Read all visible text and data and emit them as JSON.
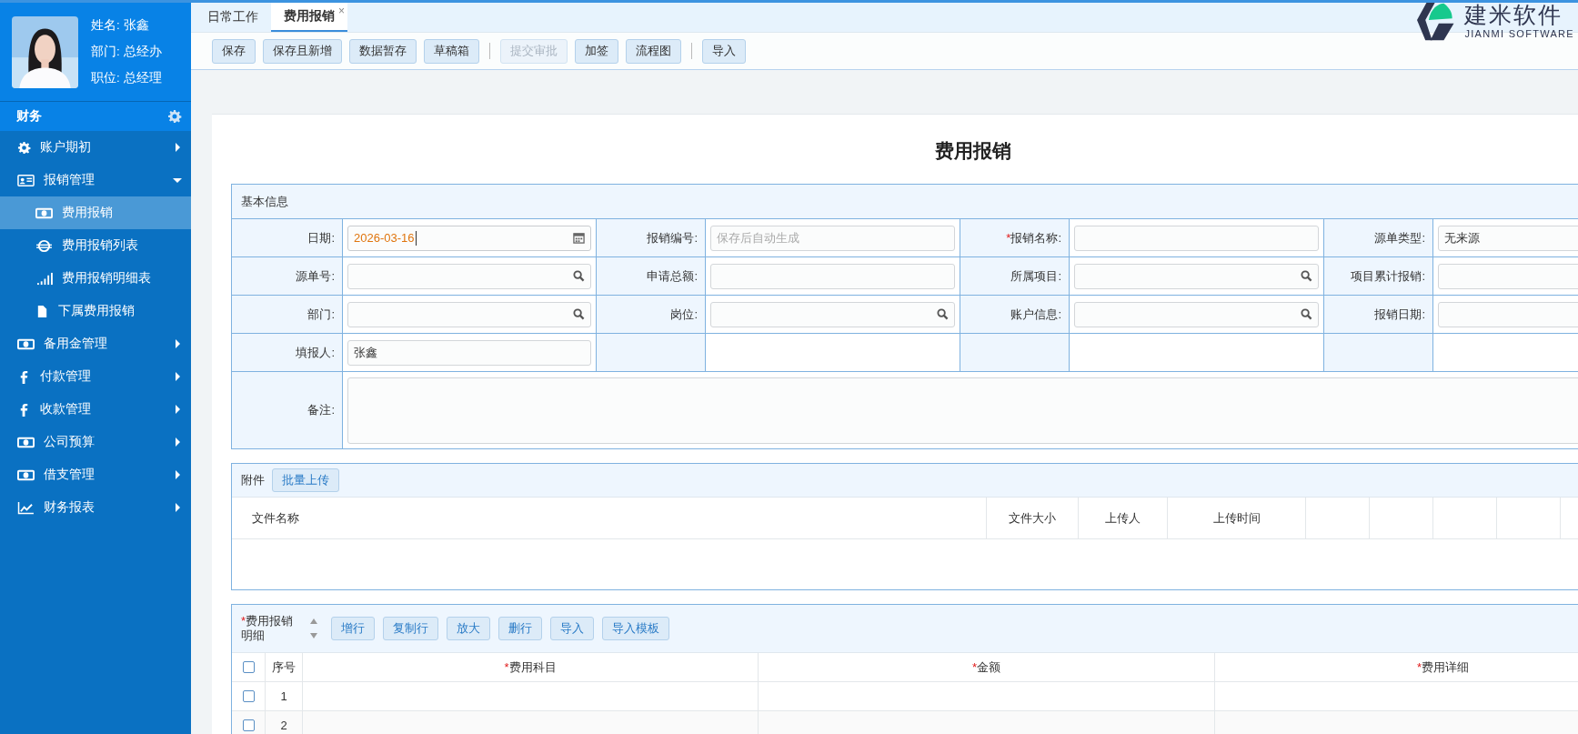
{
  "user": {
    "name": "姓名: 张鑫",
    "department": "部门: 总经办",
    "position": "职位: 总经理"
  },
  "sidebar": {
    "module": "财务",
    "items": [
      {
        "label": "账户期初",
        "expanded": false
      },
      {
        "label": "报销管理",
        "expanded": true,
        "children": [
          {
            "label": "费用报销",
            "selected": true
          },
          {
            "label": "费用报销列表",
            "selected": false
          },
          {
            "label": "费用报销明细表",
            "selected": false
          },
          {
            "label": "下属费用报销",
            "selected": false
          }
        ]
      },
      {
        "label": "备用金管理",
        "expanded": false
      },
      {
        "label": "付款管理",
        "expanded": false
      },
      {
        "label": "收款管理",
        "expanded": false
      },
      {
        "label": "公司预算",
        "expanded": false
      },
      {
        "label": "借支管理",
        "expanded": false
      },
      {
        "label": "财务报表",
        "expanded": false
      }
    ]
  },
  "tabs": [
    {
      "label": "日常工作",
      "selected": false,
      "closable": false
    },
    {
      "label": "费用报销",
      "selected": true,
      "closable": true
    }
  ],
  "close_mark": "×",
  "required_mark": "*",
  "logo": {
    "name": "建米软件",
    "tagline": "JIANMI SOFTWARE"
  },
  "toolbar": {
    "groups": [
      {
        "buttons": [
          {
            "label": "保存",
            "disabled": false
          },
          {
            "label": "保存且新增",
            "disabled": false
          },
          {
            "label": "数据暂存",
            "disabled": false
          },
          {
            "label": "草稿箱",
            "disabled": false
          }
        ]
      },
      {
        "buttons": [
          {
            "label": "提交审批",
            "disabled": true
          },
          {
            "label": "加签",
            "disabled": false
          },
          {
            "label": "流程图",
            "disabled": false
          }
        ]
      },
      {
        "buttons": [
          {
            "label": "导入",
            "disabled": false
          }
        ]
      }
    ]
  },
  "form": {
    "title": "费用报销",
    "section": "基本信息",
    "rows": [
      {
        "fields": [
          {
            "label": "日期:",
            "required": false,
            "kind": "date",
            "value": "2026-03-16",
            "focused": true
          },
          {
            "label": "报销编号:",
            "required": false,
            "kind": "text",
            "placeholder": "保存后自动生成",
            "focused": false
          },
          {
            "label": "报销名称:",
            "required": true,
            "kind": "text",
            "focused": false
          },
          {
            "label": "源单类型:",
            "required": false,
            "kind": "text",
            "value": "无来源",
            "focused": false
          }
        ]
      },
      {
        "fields": [
          {
            "label": "源单号:",
            "required": false,
            "kind": "search",
            "focused": false
          },
          {
            "label": "申请总额:",
            "required": false,
            "kind": "text",
            "focused": false
          },
          {
            "label": "所属项目:",
            "required": false,
            "kind": "search",
            "focused": false
          },
          {
            "label": "项目累计报销:",
            "required": false,
            "kind": "text",
            "focused": false
          }
        ]
      },
      {
        "fields": [
          {
            "label": "部门:",
            "required": false,
            "kind": "search",
            "focused": false
          },
          {
            "label": "岗位:",
            "required": false,
            "kind": "search",
            "focused": false
          },
          {
            "label": "账户信息:",
            "required": false,
            "kind": "search",
            "focused": false
          },
          {
            "label": "报销日期:",
            "required": false,
            "kind": "text",
            "focused": false
          }
        ]
      },
      {
        "fields": [
          {
            "label": "填报人:",
            "required": false,
            "kind": "text",
            "value": "张鑫",
            "focused": false
          }
        ]
      },
      {
        "fields": [
          {
            "label": "备注:",
            "required": false,
            "kind": "textarea"
          }
        ]
      }
    ]
  },
  "attachments": {
    "label": "附件",
    "upload_button": "批量上传",
    "columns": [
      "文件名称",
      "文件大小",
      "上传人",
      "上传时间"
    ]
  },
  "details": {
    "label": "费用报销明细",
    "required": true,
    "header_checked": false,
    "buttons": [
      "增行",
      "复制行",
      "放大",
      "删行",
      "导入",
      "导入模板"
    ],
    "columns": [
      {
        "label": "序号",
        "required": false
      },
      {
        "label": "费用科目",
        "required": true
      },
      {
        "label": "金额",
        "required": true
      },
      {
        "label": "费用详细",
        "required": true
      }
    ],
    "rows": [
      {
        "index": "1",
        "checked": false
      },
      {
        "index": "2",
        "checked": false
      }
    ]
  }
}
